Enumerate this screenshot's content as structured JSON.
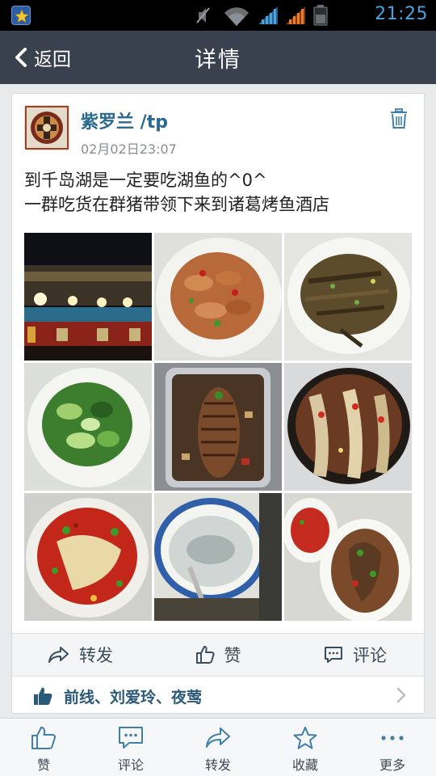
{
  "status_bar": {
    "time": "21:25",
    "icons": [
      "app-star-icon",
      "mute-icon",
      "wifi-icon",
      "signal-icon",
      "signal-orange-icon",
      "battery-icon"
    ]
  },
  "nav": {
    "back_label": "返回",
    "title": "详情"
  },
  "post": {
    "author": "紫罗兰 /tp",
    "timestamp": "02月02日23:07",
    "text_lines": [
      "到千岛湖是一定要吃湖鱼的^0^",
      "一群吃货在群猪带领下来到诸葛烤鱼酒店"
    ],
    "photos": [
      {
        "subject": "restaurant-night-facade"
      },
      {
        "subject": "fried-shrimp-plate"
      },
      {
        "subject": "small-fried-fish-plate"
      },
      {
        "subject": "green-vegetable-plate"
      },
      {
        "subject": "grilled-fish-tray"
      },
      {
        "subject": "braised-fish-pot"
      },
      {
        "subject": "chili-fish-head"
      },
      {
        "subject": "fish-soup-bowl"
      },
      {
        "subject": "steamed-fish-platter"
      }
    ],
    "actions": {
      "forward": "转发",
      "like": "赞",
      "comment": "评论"
    },
    "liked_by": "前线、刘爱玲、夜莺"
  },
  "toolbar": {
    "items": [
      {
        "label": "赞",
        "icon": "thumbs-up-icon"
      },
      {
        "label": "评论",
        "icon": "comment-icon"
      },
      {
        "label": "转发",
        "icon": "forward-icon"
      },
      {
        "label": "收藏",
        "icon": "star-icon"
      },
      {
        "label": "更多",
        "icon": "more-icon"
      }
    ]
  },
  "colors": {
    "nav_bg": "#39414e",
    "accent_blue": "#2b6a8f",
    "status_blue": "#4aa3df",
    "signal_orange": "#f07c2a"
  }
}
